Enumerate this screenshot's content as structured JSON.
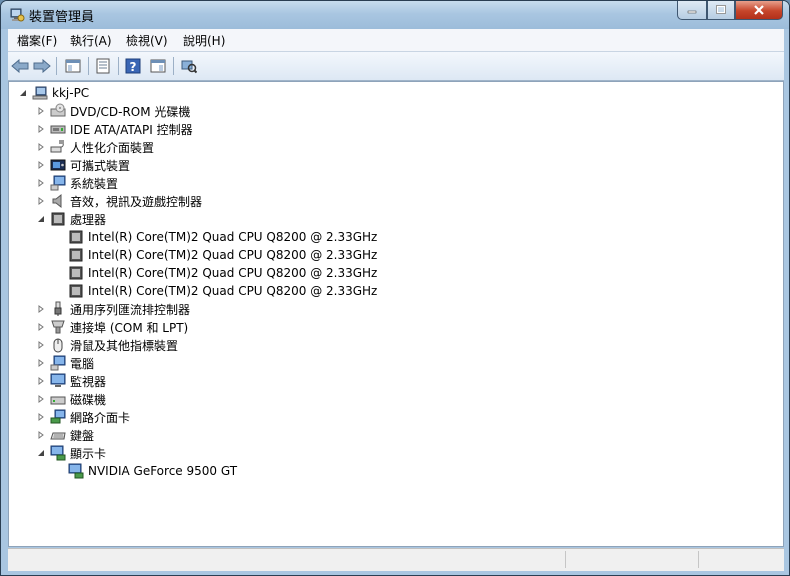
{
  "window": {
    "title": "裝置管理員"
  },
  "caption_buttons": {
    "minimize": "—",
    "maximize": "□",
    "close": "✕"
  },
  "menu": [
    {
      "label": "檔案(F)"
    },
    {
      "label": "執行(A)"
    },
    {
      "label": "檢視(V)"
    },
    {
      "label": "說明(H)"
    }
  ],
  "toolbar": [
    {
      "icon": "back-arrow-icon"
    },
    {
      "icon": "forward-arrow-icon"
    },
    {
      "icon": "show-hide-tree-icon"
    },
    {
      "icon": "properties-icon"
    },
    {
      "icon": "help-icon"
    },
    {
      "icon": "action-pane-icon"
    },
    {
      "icon": "scan-hardware-icon"
    }
  ],
  "tree": [
    {
      "label": "kkj-PC",
      "level": 0,
      "expanded": true,
      "icon": "computer-icon"
    },
    {
      "label": "DVD/CD-ROM 光碟機",
      "level": 1,
      "expanded": false,
      "icon": "dvd-drive-icon"
    },
    {
      "label": "IDE ATA/ATAPI 控制器",
      "level": 1,
      "expanded": false,
      "icon": "ide-controller-icon"
    },
    {
      "label": "人性化介面裝置",
      "level": 1,
      "expanded": false,
      "icon": "hid-icon"
    },
    {
      "label": "可攜式裝置",
      "level": 1,
      "expanded": false,
      "icon": "portable-device-icon"
    },
    {
      "label": "系統裝置",
      "level": 1,
      "expanded": false,
      "icon": "system-device-icon"
    },
    {
      "label": "音效，視訊及遊戲控制器",
      "level": 1,
      "expanded": false,
      "icon": "speaker-icon"
    },
    {
      "label": "處理器",
      "level": 1,
      "expanded": true,
      "icon": "processor-icon"
    },
    {
      "label": "Intel(R) Core(TM)2 Quad  CPU   Q8200  @ 2.33GHz",
      "level": 2,
      "icon": "processor-icon"
    },
    {
      "label": "Intel(R) Core(TM)2 Quad  CPU   Q8200  @ 2.33GHz",
      "level": 2,
      "icon": "processor-icon"
    },
    {
      "label": "Intel(R) Core(TM)2 Quad  CPU   Q8200  @ 2.33GHz",
      "level": 2,
      "icon": "processor-icon"
    },
    {
      "label": "Intel(R) Core(TM)2 Quad  CPU   Q8200  @ 2.33GHz",
      "level": 2,
      "icon": "processor-icon"
    },
    {
      "label": "通用序列匯流排控制器",
      "level": 1,
      "expanded": false,
      "icon": "usb-icon"
    },
    {
      "label": "連接埠 (COM 和 LPT)",
      "level": 1,
      "expanded": false,
      "icon": "port-icon"
    },
    {
      "label": "滑鼠及其他指標裝置",
      "level": 1,
      "expanded": false,
      "icon": "mouse-icon"
    },
    {
      "label": "電腦",
      "level": 1,
      "expanded": false,
      "icon": "computer-icon"
    },
    {
      "label": "監視器",
      "level": 1,
      "expanded": false,
      "icon": "monitor-icon"
    },
    {
      "label": "磁碟機",
      "level": 1,
      "expanded": false,
      "icon": "disk-drive-icon"
    },
    {
      "label": "網路介面卡",
      "level": 1,
      "expanded": false,
      "icon": "network-adapter-icon"
    },
    {
      "label": "鍵盤",
      "level": 1,
      "expanded": false,
      "icon": "keyboard-icon"
    },
    {
      "label": "顯示卡",
      "level": 1,
      "expanded": true,
      "icon": "display-adapter-icon"
    },
    {
      "label": "NVIDIA GeForce 9500 GT",
      "level": 2,
      "icon": "display-adapter-icon"
    }
  ]
}
